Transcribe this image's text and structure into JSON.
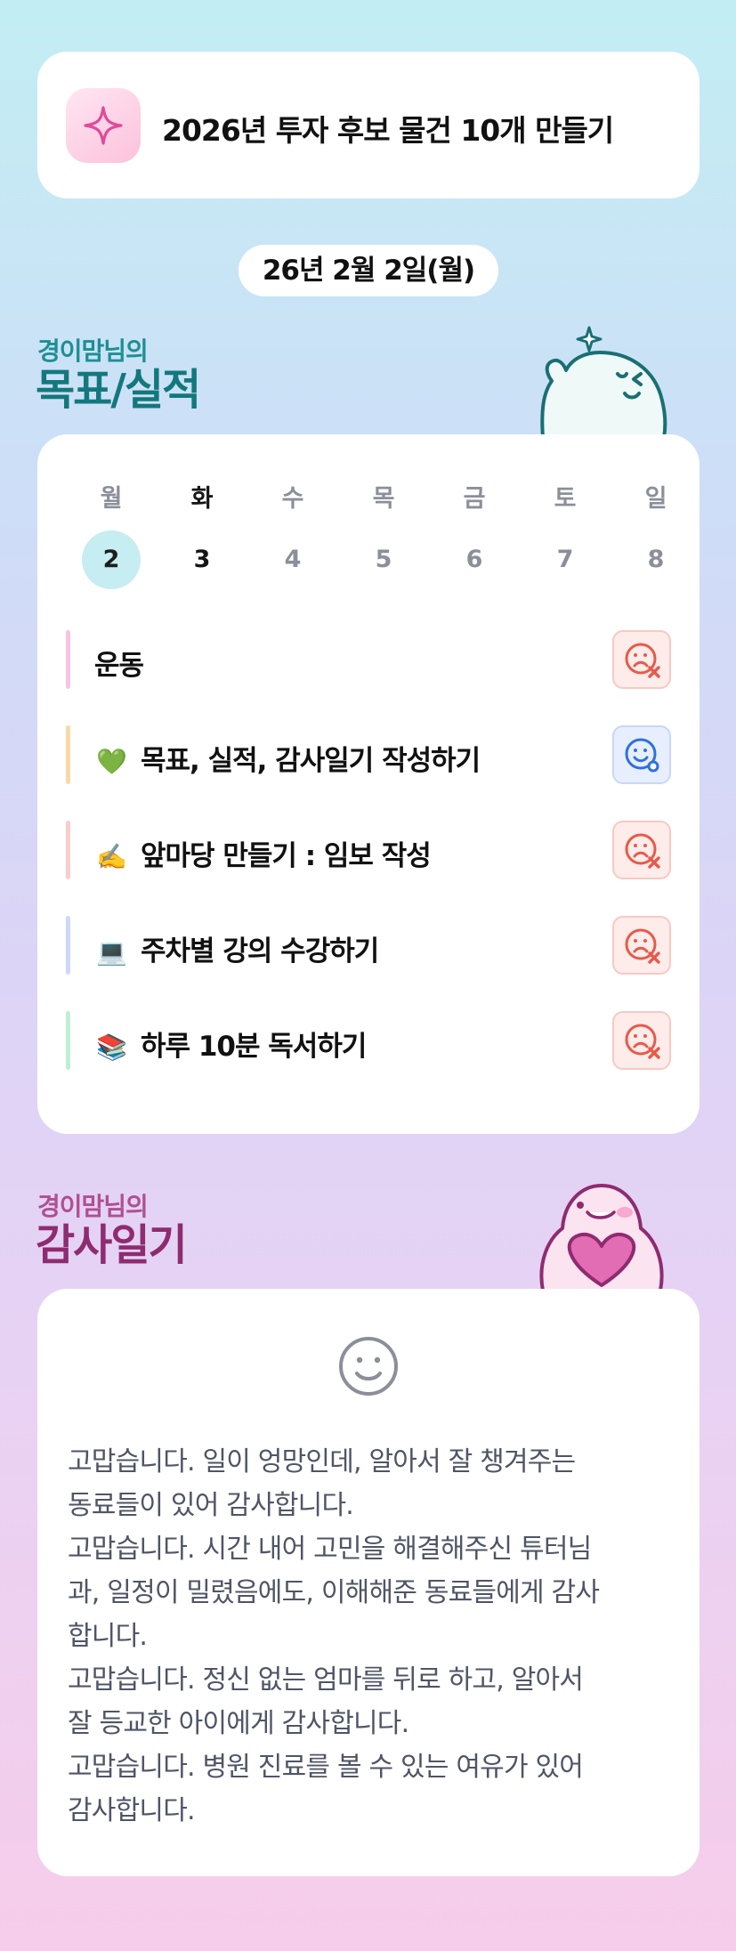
{
  "goal": {
    "title": "2026년 투자 후보 물건 10개 만들기",
    "icon": "sparkle-icon"
  },
  "date": "26년 2월 2일(월)",
  "tracker_section": {
    "subtitle": "경이맘님의",
    "title": "목표/실적"
  },
  "calendar": {
    "weekdays": [
      "월",
      "화",
      "수",
      "목",
      "금",
      "토",
      "일"
    ],
    "days": [
      "2",
      "3",
      "4",
      "5",
      "6",
      "7",
      "8"
    ],
    "selected_index": 0,
    "today_index": 1
  },
  "tasks": [
    {
      "emoji": "",
      "label": "운동",
      "bar_color": "#f8c4e2",
      "status": "sad-x-face-icon"
    },
    {
      "emoji": "💚",
      "label": "목표, 실적, 감사일기 작성하기",
      "bar_color": "#fbd8a7",
      "status": "happy-face-icon"
    },
    {
      "emoji": "✍️",
      "label": "앞마당 만들기 : 임보 작성",
      "bar_color": "#f9cdd0",
      "status": "sad-x-face-icon"
    },
    {
      "emoji": "💻",
      "label": "주차별 강의 수강하기",
      "bar_color": "#cdd8f8",
      "status": "sad-x-face-icon"
    },
    {
      "emoji": "📚",
      "label": "하루 10분 독서하기",
      "bar_color": "#bdf0d6",
      "status": "sad-x-face-icon"
    }
  ],
  "diary_section": {
    "subtitle": "경이맘님의",
    "title": "감사일기"
  },
  "diary": {
    "icon": "smile-face-icon",
    "lines": [
      "고맙습니다. 일이 엉망인데, 알아서 잘 챙겨주는",
      "동료들이 있어 감사합니다.",
      "고맙습니다. 시간 내어 고민을 해결해주신 튜터님",
      "과, 일정이 밀렸음에도, 이해해준 동료들에게 감사",
      "합니다.",
      "고맙습니다. 정신 없는 엄마를 뒤로 하고, 알아서",
      "잘 등교한 아이에게 감사합니다.",
      "고맙습니다. 병원 진료를 볼 수 있는 여유가 있어",
      "감사합니다."
    ]
  },
  "colors": {
    "accent_teal": "#1d8f94",
    "accent_plum": "#8f2b70",
    "fail": "#e8594a",
    "ok": "#2f6fe0"
  }
}
